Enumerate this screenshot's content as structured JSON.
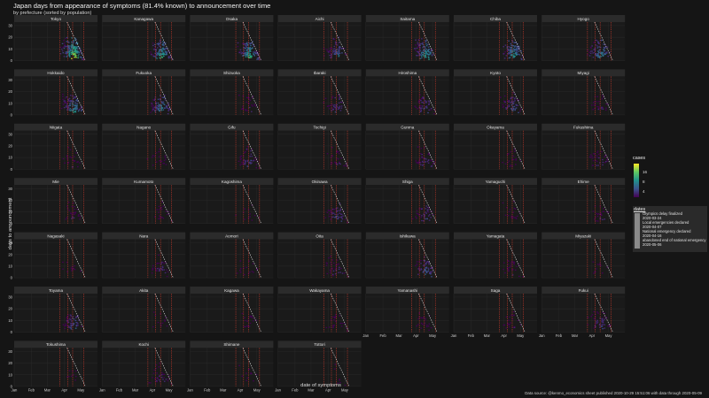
{
  "header": {
    "title": "Japan days from appearance of symptoms (81.4% known) to announcement over time",
    "subtitle": "by prefecture (sorted by population)"
  },
  "axes": {
    "ylabel": "days to announcement",
    "xlabel": "date of symptoms",
    "yticks": [
      "0",
      "10",
      "20",
      "30"
    ],
    "xticks": [
      "Jan",
      "Feb",
      "Mar",
      "Apr",
      "May"
    ]
  },
  "caption": "Data source: @kenmo_economics sheet published 2020-10-29 15:51:06 with data through 2020-05-09",
  "legend_cases": {
    "title": "cases",
    "ticks": [
      "16",
      "8",
      "4"
    ]
  },
  "legend_dates": {
    "title": "dates",
    "items": [
      {
        "label": "Olympics delay finalized",
        "date": "2020-03-24"
      },
      {
        "label": "Local emergencies declared",
        "date": "2020-04-07"
      },
      {
        "label": "National emergency declared",
        "date": "2020-04-16"
      },
      {
        "label": "abandoned end of national emergency",
        "date": "2020-05-06"
      }
    ]
  },
  "colors": {
    "background": "#151515",
    "panel": "#1a1a1a",
    "strip": "#2b2b2b",
    "event_line": "#c0392b",
    "cutoff_line": "#e6e6e6"
  },
  "chart_data": {
    "type": "heatmap",
    "title": "Japan days from appearance of symptoms (81.4% known) to announcement over time",
    "subtitle": "by prefecture (sorted by population)",
    "xlabel": "date of symptoms",
    "ylabel": "days to announcement",
    "x_range": [
      "2020-01-01",
      "2020-05-31"
    ],
    "ylim": [
      0,
      33
    ],
    "color_scale": {
      "name": "cases",
      "scale": "log",
      "ticks": [
        4,
        8,
        16
      ]
    },
    "grid": true,
    "facets": [
      {
        "name": "Tokyo",
        "intensity": 1.0
      },
      {
        "name": "Kanagawa",
        "intensity": 0.7
      },
      {
        "name": "Osaka",
        "intensity": 0.75
      },
      {
        "name": "Aichi",
        "intensity": 0.45
      },
      {
        "name": "Saitama",
        "intensity": 0.65
      },
      {
        "name": "Chiba",
        "intensity": 0.65
      },
      {
        "name": "Hyogo",
        "intensity": 0.55
      },
      {
        "name": "Hokkaido",
        "intensity": 0.6
      },
      {
        "name": "Fukuoka",
        "intensity": 0.55
      },
      {
        "name": "Shizuoka",
        "intensity": 0.15
      },
      {
        "name": "Ibaraki",
        "intensity": 0.25
      },
      {
        "name": "Hiroshima",
        "intensity": 0.3
      },
      {
        "name": "Kyoto",
        "intensity": 0.35
      },
      {
        "name": "Miyagi",
        "intensity": 0.15
      },
      {
        "name": "Niigata",
        "intensity": 0.12
      },
      {
        "name": "Nagano",
        "intensity": 0.12
      },
      {
        "name": "Gifu",
        "intensity": 0.3
      },
      {
        "name": "Tochigi",
        "intensity": 0.15
      },
      {
        "name": "Gunma",
        "intensity": 0.25
      },
      {
        "name": "Okayama",
        "intensity": 0.1
      },
      {
        "name": "Fukushima",
        "intensity": 0.2
      },
      {
        "name": "Mie",
        "intensity": 0.15
      },
      {
        "name": "Kumamoto",
        "intensity": 0.12
      },
      {
        "name": "Kagoshima",
        "intensity": 0.05
      },
      {
        "name": "Okinawa",
        "intensity": 0.3
      },
      {
        "name": "Shiga",
        "intensity": 0.25
      },
      {
        "name": "Yamaguchi",
        "intensity": 0.1
      },
      {
        "name": "Ehime",
        "intensity": 0.15
      },
      {
        "name": "Nagasaki",
        "intensity": 0.05
      },
      {
        "name": "Nara",
        "intensity": 0.2
      },
      {
        "name": "Aomori",
        "intensity": 0.08
      },
      {
        "name": "Oita",
        "intensity": 0.2
      },
      {
        "name": "Ishikawa",
        "intensity": 0.4
      },
      {
        "name": "Yamagata",
        "intensity": 0.15
      },
      {
        "name": "Miyazaki",
        "intensity": 0.05
      },
      {
        "name": "Toyama",
        "intensity": 0.35
      },
      {
        "name": "Akita",
        "intensity": 0.05
      },
      {
        "name": "Kagawa",
        "intensity": 0.1
      },
      {
        "name": "Wakayama",
        "intensity": 0.12
      },
      {
        "name": "Yamanashi",
        "intensity": 0.12
      },
      {
        "name": "Saga",
        "intensity": 0.12
      },
      {
        "name": "Fukui",
        "intensity": 0.3
      },
      {
        "name": "Tokushima",
        "intensity": 0.03
      },
      {
        "name": "Kochi",
        "intensity": 0.2
      },
      {
        "name": "Shimane",
        "intensity": 0.05
      },
      {
        "name": "Tottori",
        "intensity": 0.02
      }
    ]
  }
}
